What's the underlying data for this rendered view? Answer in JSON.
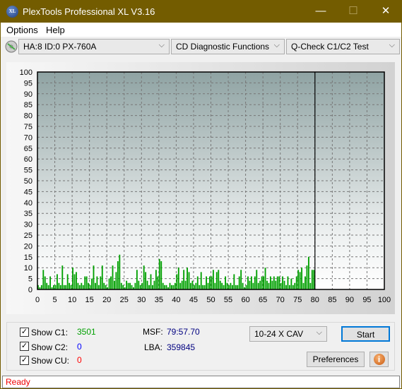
{
  "window": {
    "title": "PlexTools Professional XL V3.16",
    "logo": "XL",
    "minimize": "—",
    "maximize": "☐",
    "close": "✕"
  },
  "menu": {
    "options": "Options",
    "help": "Help"
  },
  "toolbar": {
    "drive": "HA:8 ID:0  PX-760A",
    "function": "CD Diagnostic Functions",
    "test": "Q-Check C1/C2 Test",
    "drive_icon": "cd-disc-icon"
  },
  "chart_data": {
    "type": "bar",
    "xlim": [
      0,
      100
    ],
    "ylim": [
      0,
      100
    ],
    "xticks": [
      0,
      5,
      10,
      15,
      20,
      25,
      30,
      35,
      40,
      45,
      50,
      55,
      60,
      65,
      70,
      75,
      80,
      85,
      90,
      95,
      100
    ],
    "yticks": [
      0,
      5,
      10,
      15,
      20,
      25,
      30,
      35,
      40,
      45,
      50,
      55,
      60,
      65,
      70,
      75,
      80,
      85,
      90,
      95,
      100
    ],
    "grid": true,
    "end_marker_x": 80,
    "x_step": 0.5,
    "series": [
      {
        "color": "#00a000",
        "values": [
          2,
          1,
          2,
          9,
          6,
          3,
          2,
          6,
          1,
          2,
          2,
          7,
          3,
          2,
          11,
          2,
          2,
          7,
          3,
          2,
          10,
          7,
          8,
          3,
          2,
          3,
          2,
          6,
          6,
          3,
          2,
          5,
          11,
          3,
          6,
          2,
          6,
          11,
          3,
          2,
          1,
          5,
          6,
          11,
          4,
          8,
          13,
          16,
          3,
          2,
          1,
          4,
          3,
          3,
          2,
          1,
          3,
          9,
          4,
          2,
          3,
          11,
          8,
          4,
          2,
          7,
          2,
          4,
          9,
          6,
          14,
          13,
          3,
          2,
          2,
          1,
          3,
          2,
          2,
          3,
          7,
          10,
          3,
          4,
          9,
          4,
          10,
          8,
          3,
          4,
          2,
          3,
          6,
          2,
          8,
          2,
          2,
          6,
          3,
          6,
          6,
          9,
          3,
          8,
          9,
          4,
          3,
          2,
          6,
          3,
          2,
          3,
          2,
          7,
          2,
          2,
          6,
          9,
          3,
          1,
          2,
          6,
          4,
          6,
          3,
          6,
          9,
          3,
          4,
          6,
          6,
          10,
          4,
          3,
          6,
          4,
          6,
          4,
          6,
          6,
          3,
          6,
          4,
          2,
          6,
          2,
          5,
          2,
          3,
          6,
          9,
          8,
          10,
          3,
          6,
          11,
          15,
          3,
          9,
          9
        ]
      }
    ]
  },
  "stats": {
    "show_c1": "Show C1:",
    "c1_value": "3501",
    "show_c2": "Show C2:",
    "c2_value": "0",
    "show_cu": "Show CU:",
    "cu_value": "0",
    "msf_label": "MSF:",
    "msf_value": "79:57.70",
    "lba_label": "LBA:",
    "lba_value": "359845",
    "check": "✓"
  },
  "controls": {
    "speed": "10-24 X CAV",
    "start": "Start",
    "preferences": "Preferences",
    "info": "i"
  },
  "status": "Ready",
  "colors": {
    "titlebar": "#735c00",
    "c1": "#00a000",
    "c2": "#0000ff",
    "cu": "#ff0000"
  }
}
